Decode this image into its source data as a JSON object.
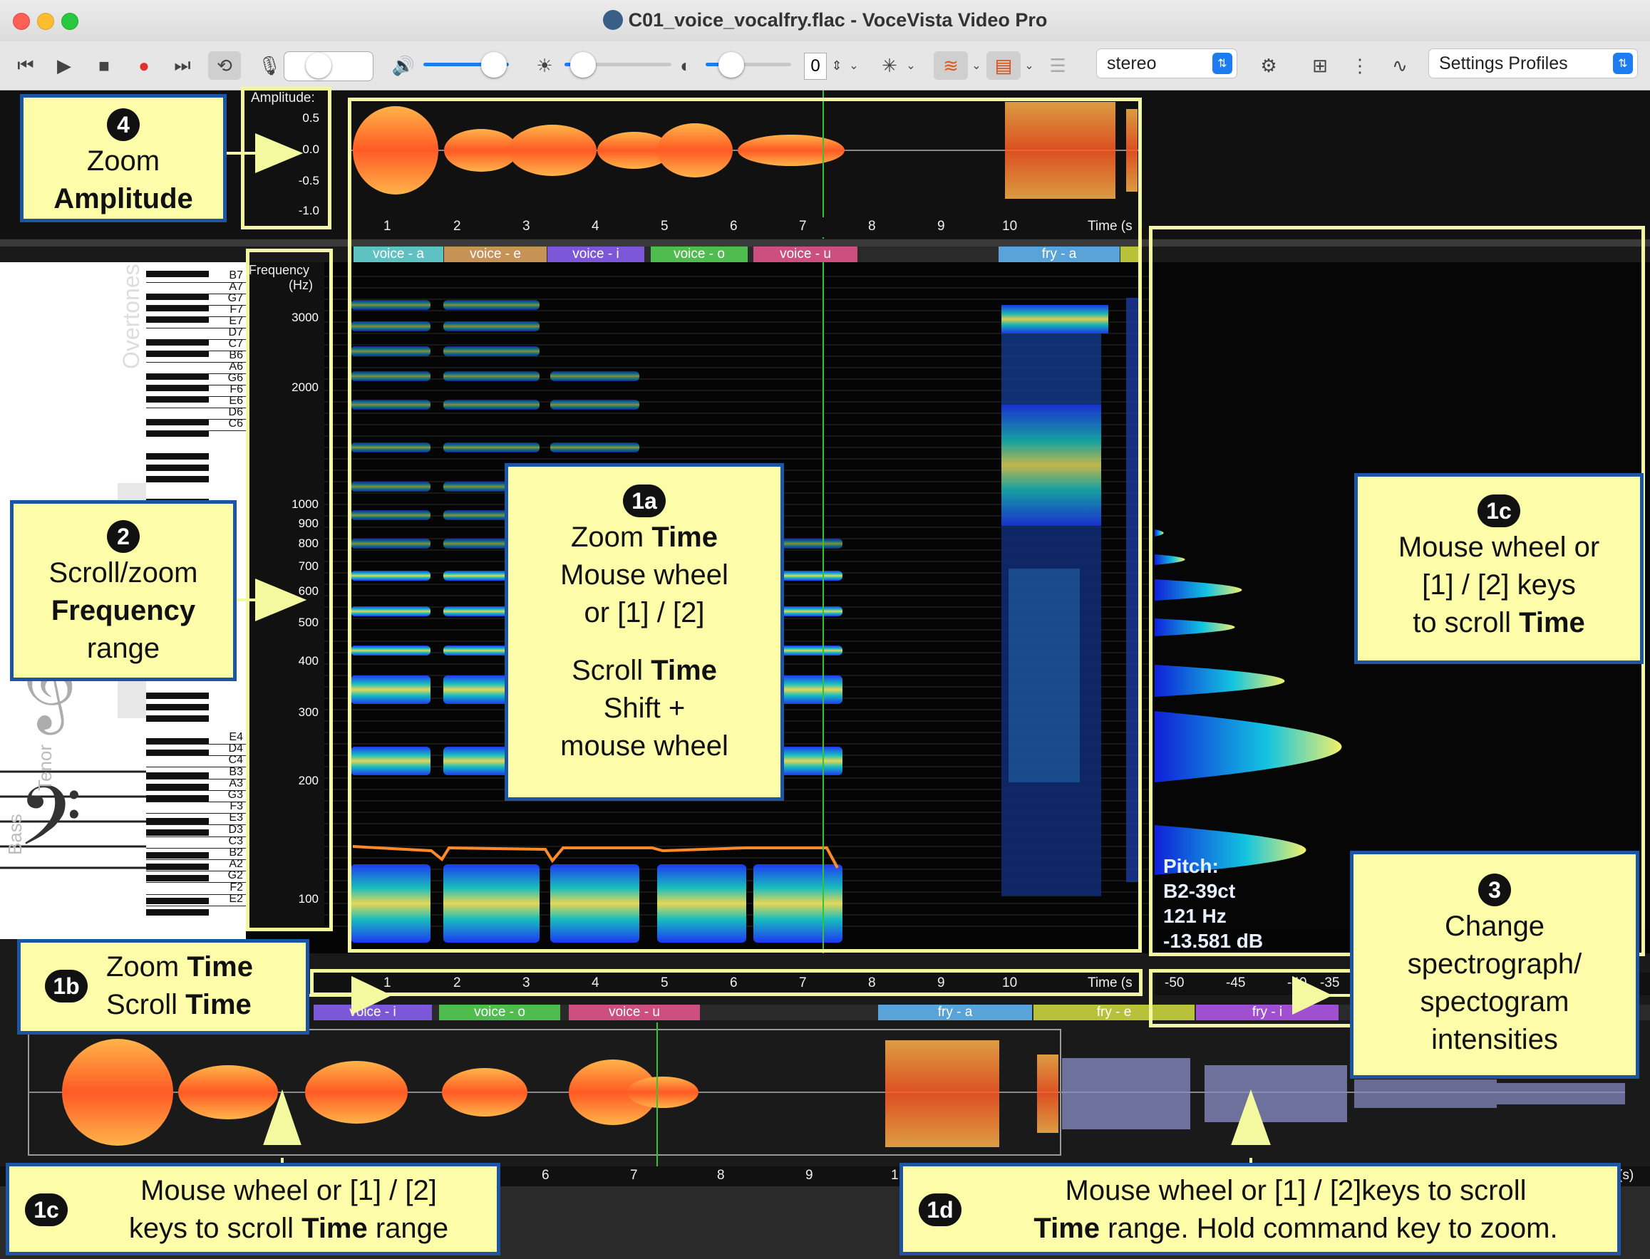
{
  "window": {
    "title": "C01_voice_vocalfry.flac - VoceVista Video Pro"
  },
  "toolbar": {
    "number_value": "0",
    "channel_select": "stereo",
    "settings_profiles": "Settings Profiles"
  },
  "amplitude_axis": {
    "label": "Amplitude:",
    "ticks": [
      "0.5",
      "0.0",
      "-0.5",
      "-1.0"
    ]
  },
  "frequency_axis": {
    "label_line1": "Frequency",
    "label_line2": "(Hz)",
    "ticks": [
      "3000",
      "2000",
      "1000",
      "900",
      "800",
      "700",
      "600",
      "500",
      "400",
      "300",
      "200",
      "100"
    ]
  },
  "time_axis": {
    "ticks": [
      "1",
      "2",
      "3",
      "4",
      "5",
      "6",
      "7",
      "8",
      "9",
      "10"
    ],
    "unit": "Time (s"
  },
  "lower_time_axis": {
    "ticks": [
      "6",
      "7",
      "8",
      "9",
      "1"
    ],
    "unit": "(s)"
  },
  "spectrum_axis": {
    "ticks": [
      "-50",
      "-45",
      "-40",
      "-35"
    ]
  },
  "segments_top": [
    "voice - a",
    "voice - e",
    "voice - i",
    "voice - o",
    "voice - u",
    "fry - a"
  ],
  "segments_lower": [
    "voice - i",
    "voice - o",
    "voice - u",
    "fry - a",
    "fry - e",
    "fry - i"
  ],
  "keyboard_notes": [
    "B7",
    "A7",
    "G7",
    "F7",
    "E7",
    "D7",
    "C7",
    "B6",
    "A6",
    "G6",
    "F6",
    "E6",
    "D6",
    "C6",
    "E4",
    "D4",
    "C4",
    "B3",
    "A3",
    "G3",
    "F3",
    "E3",
    "D3",
    "C3",
    "B2",
    "A2",
    "G2",
    "F2",
    "E2"
  ],
  "staff_labels": {
    "overtones": "Overtones",
    "tenor": "Tenor",
    "bass": "Bass"
  },
  "pitch_readout": {
    "label": "Pitch:",
    "note": "B2-39ct",
    "freq": "121 Hz",
    "level": "-13.581 dB"
  },
  "callouts": {
    "c4": {
      "badge": "4",
      "line1": "Zoom",
      "line2": "Amplitude"
    },
    "c2": {
      "badge": "2",
      "line1": "Scroll/zoom",
      "line2": "Frequency",
      "line3": "range"
    },
    "c1a": {
      "badge": "1a",
      "l1a": "Zoom ",
      "l1b": "Time",
      "l2": "Mouse wheel",
      "l3": "or [1] / [2]",
      "l4a": "Scroll ",
      "l4b": "Time",
      "l5": "Shift +",
      "l6": "mouse wheel"
    },
    "c1c_right": {
      "badge": "1c",
      "l1": "Mouse wheel or",
      "l2": "[1] / [2] keys",
      "l3a": "to scroll ",
      "l3b": "Time"
    },
    "c1b": {
      "badge": "1b",
      "l1a": "Zoom ",
      "l1b": "Time",
      "l2a": "Scroll ",
      "l2b": "Time"
    },
    "c3": {
      "badge": "3",
      "l1": "Change",
      "l2": "spectrograph/",
      "l3": "spectogram",
      "l4": "intensities"
    },
    "c1c_bottom": {
      "badge": "1c",
      "l1": "Mouse wheel or [1] / [2]",
      "l2a": "keys to scroll ",
      "l2b": "Time",
      "l2c": " range"
    },
    "c1d": {
      "badge": "1d",
      "l1": "Mouse wheel or [1] / [2]keys to scroll",
      "l2a": "Time",
      "l2b": " range. Hold command key to zoom."
    }
  },
  "colors": {
    "callout_bg": "#fcfca9",
    "callout_border": "#1b55a3",
    "highlight": "#f4f9a0",
    "waveform": "#ff6a2a",
    "accent": "#1e7cf2"
  }
}
